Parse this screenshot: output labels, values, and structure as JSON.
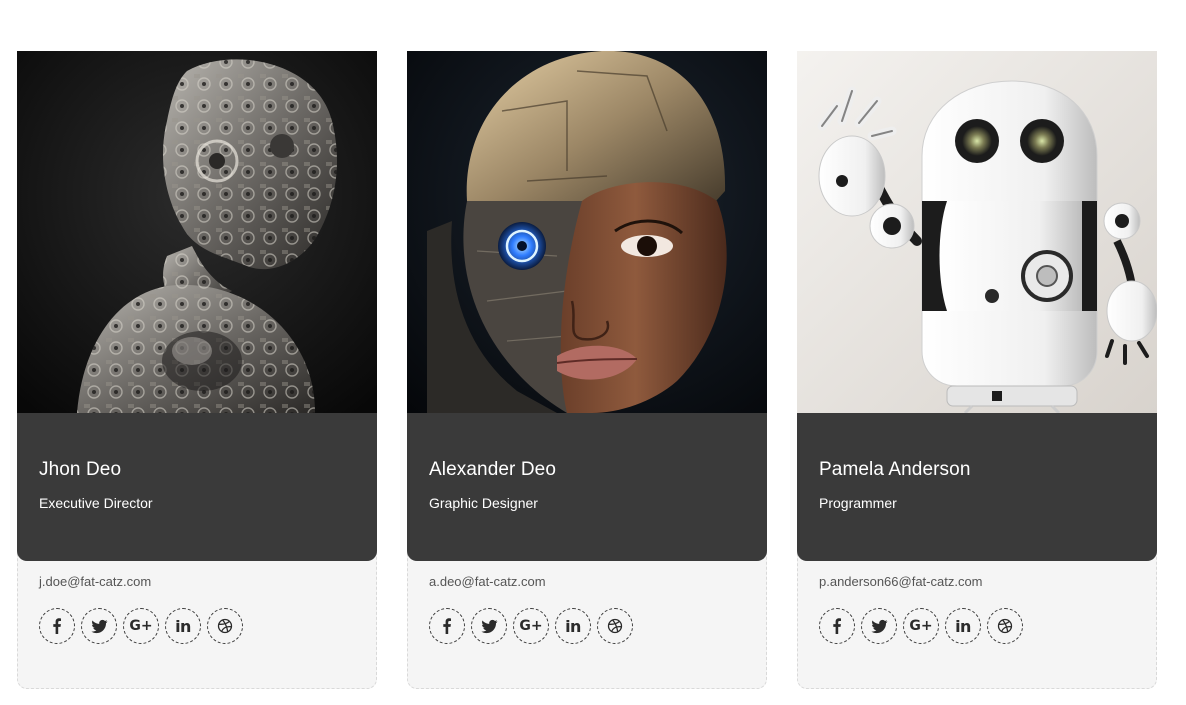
{
  "team": [
    {
      "name": "Jhon Deo",
      "role": "Executive Director",
      "email": "j.doe@fat-catz.com",
      "photo_icon": "steampunk-robot-photo"
    },
    {
      "name": "Alexander Deo",
      "role": "Graphic Designer",
      "email": "a.deo@fat-catz.com",
      "photo_icon": "cyborg-woman-photo"
    },
    {
      "name": "Pamela Anderson",
      "role": "Programmer",
      "email": "p.anderson66@fat-catz.com",
      "photo_icon": "white-robot-photo"
    }
  ],
  "social_icons": [
    "facebook-icon",
    "twitter-icon",
    "google-plus-icon",
    "linkedin-icon",
    "dribbble-icon"
  ],
  "colors": {
    "info_bg": "#3a3a3a",
    "contact_bg": "#f5f5f5",
    "text_light": "#ffffff",
    "icon_dark": "#2b2b2b"
  }
}
